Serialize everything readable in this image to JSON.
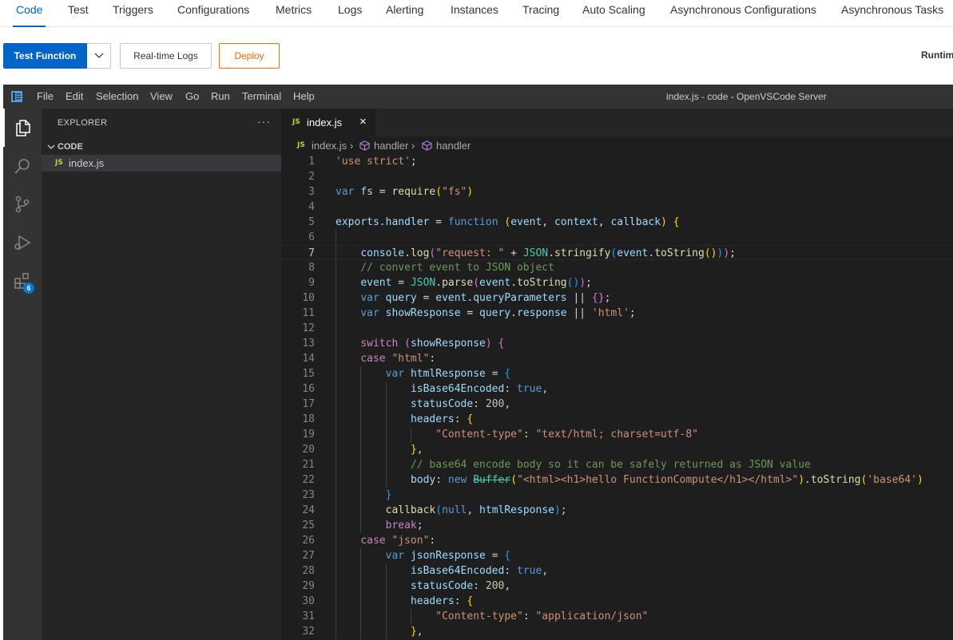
{
  "top_tabs": [
    {
      "label": "Code",
      "active": true
    },
    {
      "label": "Test"
    },
    {
      "label": "Triggers"
    },
    {
      "label": "Configurations"
    },
    {
      "label": "Metrics"
    },
    {
      "label": "Logs"
    },
    {
      "label": "Alerting"
    },
    {
      "label": "Instances"
    },
    {
      "label": "Tracing"
    },
    {
      "label": "Auto Scaling"
    },
    {
      "label": "Asynchronous Configurations"
    },
    {
      "label": "Asynchronous Tasks"
    }
  ],
  "toolbar": {
    "test_function": "Test Function",
    "realtime_logs": "Real-time Logs",
    "deploy": "Deploy",
    "runtime": "Runtim"
  },
  "colors": {
    "accent": "#0064c8",
    "deploy": "#ff6a00"
  },
  "vscode": {
    "menu": [
      "File",
      "Edit",
      "Selection",
      "View",
      "Go",
      "Run",
      "Terminal",
      "Help"
    ],
    "window_title": "index.js - code - OpenVSCode Server",
    "extensions_badge": "6",
    "explorer": {
      "title": "EXPLORER",
      "more": "···",
      "section": "CODE",
      "files": [
        {
          "name": "index.js",
          "icon": "js-icon"
        }
      ]
    },
    "tab": {
      "name": "index.js",
      "icon_text": "JS",
      "close": "×"
    },
    "breadcrumb": [
      "index.js",
      "handler",
      "handler"
    ],
    "current_line": 7,
    "code_lines": [
      "'use strict';",
      "",
      "var fs = require(\"fs\")",
      "",
      "exports.handler = function (event, context, callback) {",
      "",
      "    console.log(\"request: \" + JSON.stringify(event.toString()));",
      "    // convert event to JSON object",
      "    event = JSON.parse(event.toString());",
      "    var query = event.queryParameters || {};",
      "    var showResponse = query.response || 'html';",
      "",
      "    switch (showResponse) {",
      "    case \"html\":",
      "        var htmlResponse = {",
      "            isBase64Encoded: true,",
      "            statusCode: 200,",
      "            headers: {",
      "                \"Content-type\": \"text/html; charset=utf-8\"",
      "            },",
      "            // base64 encode body so it can be safely returned as JSON value",
      "            body: new Buffer(\"<html><h1>hello FunctionCompute</h1></html>\").toString('base64')",
      "        }",
      "        callback(null, htmlResponse);",
      "        break;",
      "    case \"json\":",
      "        var jsonResponse = {",
      "            isBase64Encoded: true,",
      "            statusCode: 200,",
      "            headers: {",
      "                \"Content-type\": \"application/json\"",
      "            },"
    ]
  }
}
